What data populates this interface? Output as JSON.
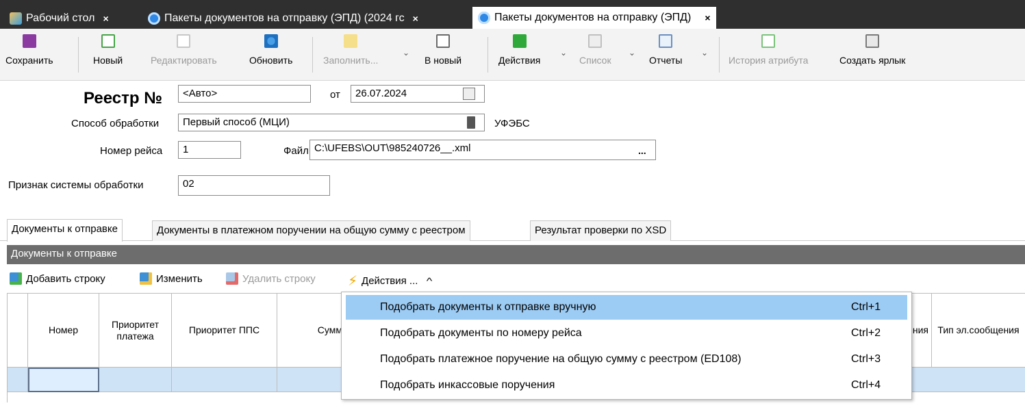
{
  "tabs": [
    {
      "label": "Рабочий стол",
      "close": "×",
      "icon": "desktop-icon"
    },
    {
      "label": "Пакеты документов на отправку  (ЭПД) (2024 гс",
      "close": "×",
      "icon": "package-icon"
    },
    {
      "label": "Пакеты документов на отправку  (ЭПД)",
      "close": "×",
      "icon": "package-icon",
      "active": true
    }
  ],
  "toolbar": {
    "save": "Сохранить",
    "new": "Новый",
    "edit": "Редактировать",
    "refresh": "Обновить",
    "fill": "Заполнить...",
    "to_new": "В новый",
    "actions": "Действия",
    "list": "Список",
    "reports": "Отчеты",
    "attr_history": "История атрибута",
    "create_shortcut": "Создать ярлык"
  },
  "form": {
    "registry_title": "Реестр №",
    "registry_number": "<Авто>",
    "from_label": "от",
    "date": "26.07.2024",
    "processing_method_label": "Способ обработки",
    "processing_method": "Первый способ (МЦИ)",
    "format": "УФЭБС",
    "flight_number_label": "Номер рейса",
    "flight_number": "1",
    "file_label": "Файл",
    "file_path": "C:\\UFEBS\\OUT\\985240726__.xml",
    "file_browse": "...",
    "system_sign_label": "Признак системы обработки",
    "system_sign": "02"
  },
  "lower_tabs": [
    "Документы к отправке",
    "Документы в платежном поручении на общую сумму с реестром",
    "Результат проверки по XSD"
  ],
  "group": {
    "header": "Документы к отправке",
    "add_row": "Добавить строку",
    "edit": "Изменить",
    "delete_row": "Удалить строку",
    "actions": "Действия ...",
    "actions_caret": "^"
  },
  "grid": {
    "columns": [
      "Номер",
      "Приоритет платежа",
      "Приоритет ППС",
      "Сумм",
      "ния",
      "Тип эл.сообщения"
    ]
  },
  "menu": {
    "items": [
      {
        "label": "Подобрать документы к отправке вручную",
        "shortcut": "Ctrl+1",
        "highlighted": true
      },
      {
        "label": "Подобрать документы по номеру рейса",
        "shortcut": "Ctrl+2"
      },
      {
        "label": "Подобрать платежное поручение на общую сумму с реестром (ED108)",
        "shortcut": "Ctrl+3"
      },
      {
        "label": "Подобрать инкассовые поручения",
        "shortcut": "Ctrl+4"
      }
    ]
  }
}
